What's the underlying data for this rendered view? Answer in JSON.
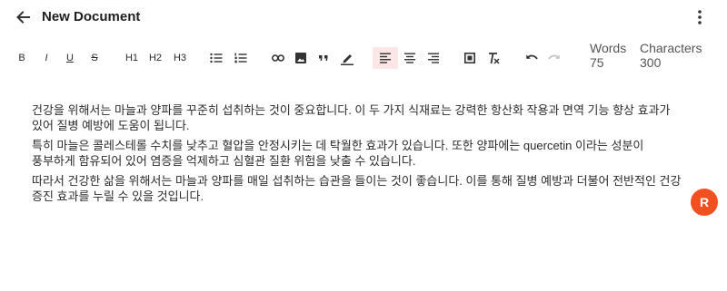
{
  "header": {
    "title": "New Document"
  },
  "toolbar": {
    "bold": "B",
    "italic": "I",
    "underline": "U",
    "strike": "S",
    "h1": "H1",
    "h2": "H2",
    "h3": "H3"
  },
  "stats": {
    "words_label": "Words",
    "words_value": "75",
    "characters_label": "Characters",
    "characters_value": "300"
  },
  "content": {
    "paragraphs": [
      "건강을 위해서는 마늘과 양파를 꾸준히 섭취하는 것이 중요합니다. 이 두 가지 식재료는 강력한 항산화 작용과 면역 기능 향상 효과가 있어 질병 예방에 도움이 됩니다.",
      "특히 마늘은 콜레스테롤 수치를 낮추고 혈압을 안정시키는 데 탁월한 효과가 있습니다. 또한 양파에는 quercetin 이라는 성분이 풍부하게 함유되어 있어 염증을 억제하고 심혈관 질환 위험을 낮출 수 있습니다.",
      "따라서 건강한 삶을 위해서는 마늘과 양파를 매일 섭취하는 습관을 들이는 것이 좋습니다. 이를 통해 질병 예방과 더불어 전반적인 건강 증진 효과를 누릴 수 있을 것입니다."
    ]
  },
  "avatar": {
    "initial": "R",
    "color": "#f2501e"
  },
  "colors": {
    "active_bg": "#fde7e6"
  },
  "icons": [
    "arrow-left-icon",
    "more-vertical-icon",
    "bullet-list-icon",
    "ordered-list-icon",
    "link-icon",
    "image-icon",
    "quote-icon",
    "highlight-pen-icon",
    "align-left-icon",
    "align-center-icon",
    "align-right-icon",
    "table-icon",
    "clear-format-icon",
    "undo-icon",
    "redo-icon"
  ]
}
